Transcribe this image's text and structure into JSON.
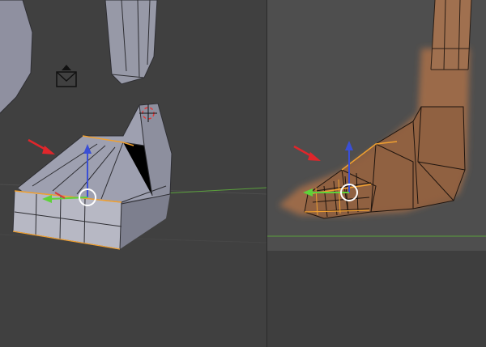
{
  "viewports": [
    {
      "name": "3d-viewport-solid",
      "shading": "solid"
    },
    {
      "name": "3d-viewport-wireframe",
      "shading": "wireframe"
    }
  ],
  "colors": {
    "background": "#404040",
    "mesh_gray": "#9a9aa8",
    "skin": "#a06d4b",
    "annotation_arrow": "#e0262b",
    "selected_edge": "#f0a030",
    "axis_x": "#d63c3c",
    "axis_y": "#5ed23a",
    "axis_z": "#3a4fd6",
    "cursor_ring": "#ffffff",
    "floor_line": "#5aa03c"
  },
  "icons": [
    "lamp-icon",
    "3d-cursor-icon",
    "transform-gizmo-icon"
  ]
}
